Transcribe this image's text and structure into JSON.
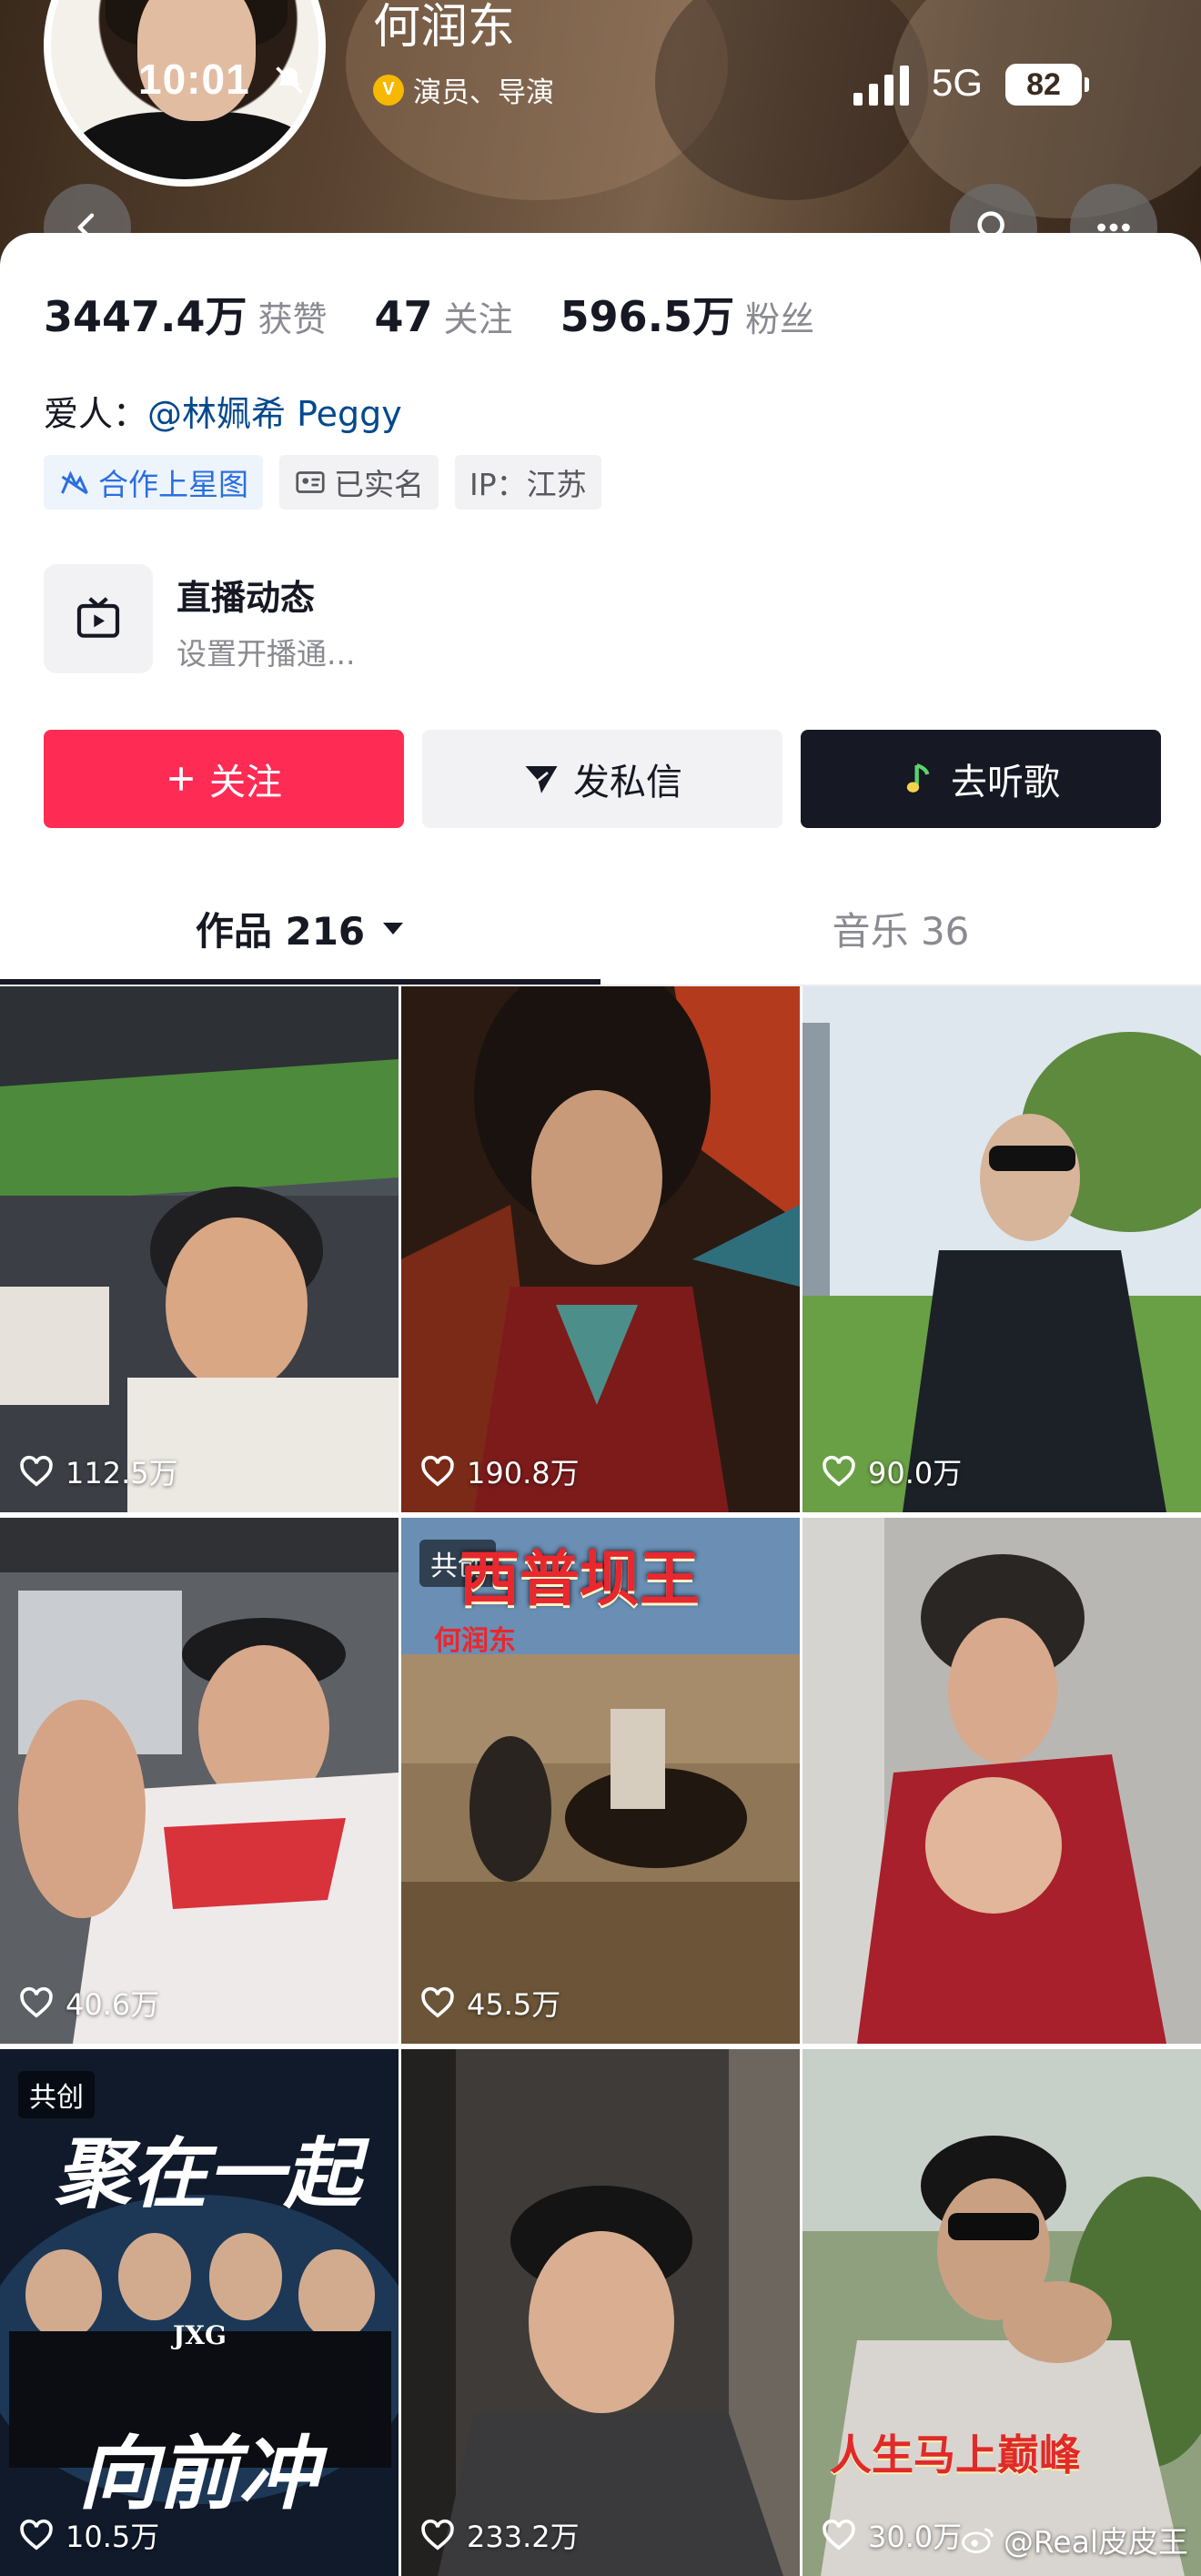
{
  "status_bar": {
    "time": "10:01",
    "network": "5G",
    "battery": "82"
  },
  "profile": {
    "name": "何润东",
    "verified_text": "演员、导演",
    "stats": [
      {
        "value": "3447.4万",
        "label": "获赞"
      },
      {
        "value": "47",
        "label": "关注"
      },
      {
        "value": "596.5万",
        "label": "粉丝"
      }
    ],
    "partner_label": "爱人：",
    "partner_link": "@林姵希 Peggy",
    "tags": [
      "合作上星图",
      "已实名",
      "IP：江苏"
    ],
    "live": {
      "title": "直播动态",
      "subtitle": "设置开播通..."
    }
  },
  "actions": {
    "follow": "关注",
    "message": "发私信",
    "music": "去听歌"
  },
  "tabs": {
    "works": "作品 216",
    "music": "音乐 36"
  },
  "grid": [
    {
      "likes": "112.5万"
    },
    {
      "likes": "190.8万"
    },
    {
      "likes": "90.0万"
    },
    {
      "likes": "40.6万"
    },
    {
      "likes": "45.5万",
      "badge": "共创",
      "poster_title": "西普坝王",
      "poster_sub": "何润东"
    },
    {
      "likes": ""
    },
    {
      "likes": "10.5万",
      "badge": "共创",
      "poster_title": "聚在一起",
      "poster_title2": "向前冲",
      "logo": "JXG"
    },
    {
      "likes": "233.2万"
    },
    {
      "likes": "30.0万",
      "poster_title": "人生马上巅峰"
    }
  ],
  "watermark": "@Real皮皮王",
  "colors": {
    "accent_red": "#fe2c55",
    "dark": "#161823",
    "link_blue": "#04498d",
    "tag_blue": "#2b6fe0"
  }
}
